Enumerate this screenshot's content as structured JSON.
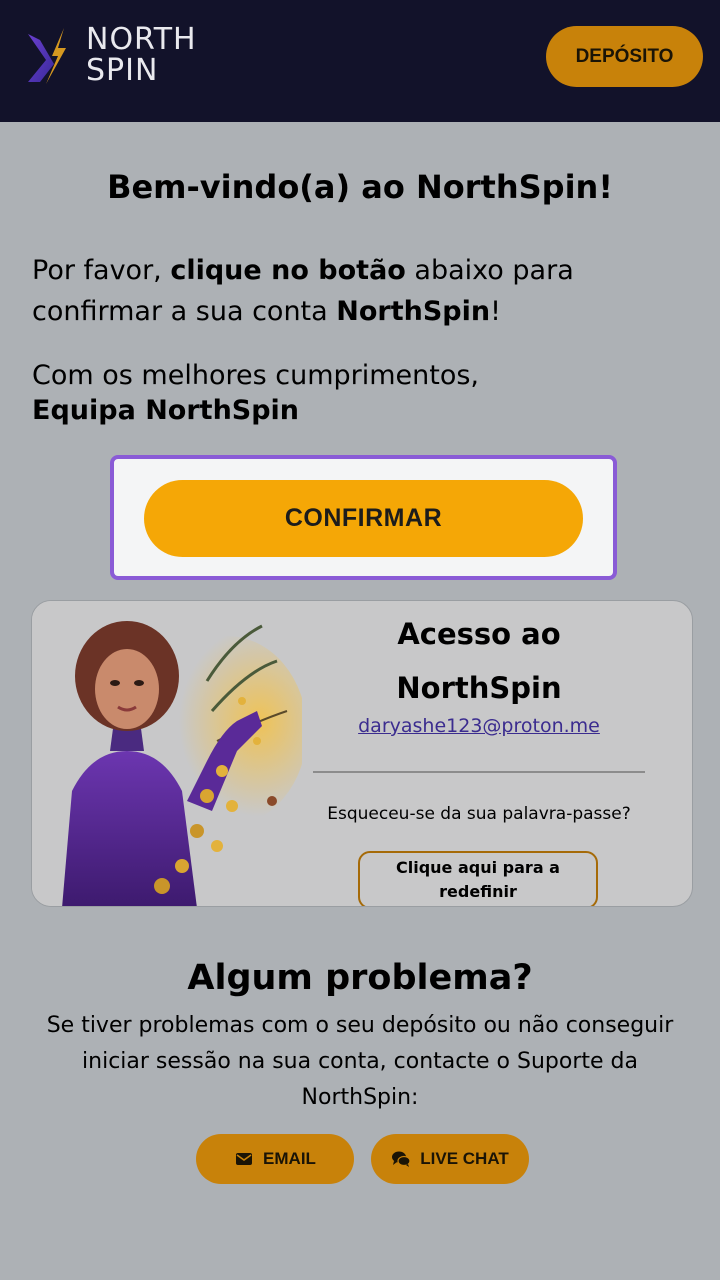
{
  "header": {
    "logo_line1": "NORTH",
    "logo_line2": "SPIN",
    "deposit_label": "DEPÓSITO"
  },
  "main": {
    "welcome_title": "Bem-vindo(a) ao NorthSpin!",
    "p1_part1": "Por favor, ",
    "p1_bold1": "clique no botão",
    "p1_part2": " abaixo para confirmar a sua conta ",
    "p1_bold2": "NorthSpin",
    "p1_part3": "!",
    "p2_line1": "Com os melhores cumprimentos,",
    "p2_line2": "Equipa NorthSpin",
    "confirm_label": "CONFIRMAR"
  },
  "access_card": {
    "title": "Acesso ao NorthSpin",
    "email": "daryashe123@proton.me",
    "forgot_text": "Esqueceu-se da sua palavra-passe?",
    "reset_label": "Clique aqui para a redefinir"
  },
  "support": {
    "title": "Algum problema?",
    "text": "Se tiver problemas com o seu depósito ou não conseguir iniciar sessão na sua conta, contacte o Suporte da NorthSpin:",
    "email_label": "EMAIL",
    "chat_label": "LIVE CHAT"
  },
  "colors": {
    "header_bg": "#12122a",
    "accent": "#f5a706",
    "accent_dim": "#c8820a",
    "focus_ring": "#8a5bd6"
  },
  "icons": [
    "northspin-logo-icon",
    "envelope-icon",
    "chat-bubbles-icon"
  ]
}
